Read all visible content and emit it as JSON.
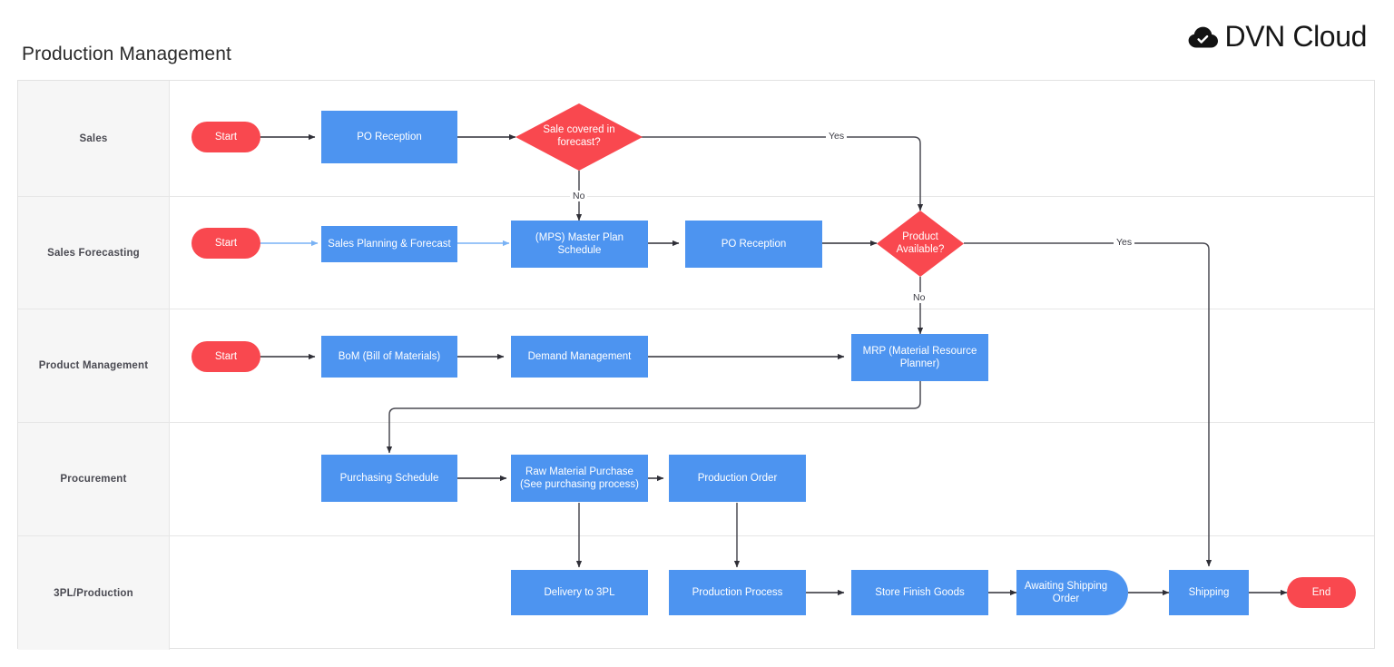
{
  "page": {
    "title": "Production Management",
    "brand": "DVN Cloud",
    "brand_icon": "cloud-check-icon"
  },
  "colors": {
    "process_blue": "#4d94f0",
    "terminator_red": "#f9484f",
    "decision_red": "#f9484f",
    "lane_header_bg": "#f6f6f6",
    "lane_border": "#e6e6e6",
    "connector_dark": "#3c3c44",
    "connector_blue": "#79b2f5",
    "text_dark": "#2b2b2b"
  },
  "lanes": [
    {
      "id": "sales",
      "label": "Sales"
    },
    {
      "id": "sales-forecasting",
      "label": "Sales Forecasting"
    },
    {
      "id": "product-management",
      "label": "Product Management"
    },
    {
      "id": "procurement",
      "label": "Procurement"
    },
    {
      "id": "3pl-production",
      "label": "3PL/Production"
    }
  ],
  "nodes": [
    {
      "id": "start-sales",
      "lane": "sales",
      "shape": "terminator",
      "label": "Start"
    },
    {
      "id": "po-reception-sales",
      "lane": "sales",
      "shape": "process",
      "label": "PO Reception"
    },
    {
      "id": "sale-covered",
      "lane": "sales",
      "shape": "decision",
      "label": "Sale covered in forecast?"
    },
    {
      "id": "start-forecasting",
      "lane": "sales-forecasting",
      "shape": "terminator",
      "label": "Start"
    },
    {
      "id": "sales-planning",
      "lane": "sales-forecasting",
      "shape": "process",
      "label": "Sales Planning & Forecast"
    },
    {
      "id": "mps",
      "lane": "sales-forecasting",
      "shape": "process",
      "label": "(MPS) Master Plan Schedule"
    },
    {
      "id": "po-reception-forecast",
      "lane": "sales-forecasting",
      "shape": "process",
      "label": "PO Reception"
    },
    {
      "id": "product-available",
      "lane": "sales-forecasting",
      "shape": "decision",
      "label": "Product Available?"
    },
    {
      "id": "start-product",
      "lane": "product-management",
      "shape": "terminator",
      "label": "Start"
    },
    {
      "id": "bom",
      "lane": "product-management",
      "shape": "process",
      "label": "BoM (Bill of Materials)"
    },
    {
      "id": "demand-management",
      "lane": "product-management",
      "shape": "process",
      "label": "Demand Management"
    },
    {
      "id": "mrp",
      "lane": "product-management",
      "shape": "process",
      "label": "MRP (Material Resource Planner)"
    },
    {
      "id": "purchasing-schedule",
      "lane": "procurement",
      "shape": "process",
      "label": "Purchasing Schedule"
    },
    {
      "id": "raw-material-purchase",
      "lane": "procurement",
      "shape": "process",
      "label": "Raw Material Purchase (See purchasing process)"
    },
    {
      "id": "production-order",
      "lane": "procurement",
      "shape": "process",
      "label": "Production Order"
    },
    {
      "id": "delivery-to-3pl",
      "lane": "3pl-production",
      "shape": "process",
      "label": "Delivery to 3PL"
    },
    {
      "id": "production-process",
      "lane": "3pl-production",
      "shape": "process",
      "label": "Production Process"
    },
    {
      "id": "store-finish-goods",
      "lane": "3pl-production",
      "shape": "process",
      "label": "Store Finish Goods"
    },
    {
      "id": "awaiting-shipping",
      "lane": "3pl-production",
      "shape": "delay",
      "label": "Awaiting Shipping Order"
    },
    {
      "id": "shipping",
      "lane": "3pl-production",
      "shape": "process",
      "label": "Shipping"
    },
    {
      "id": "end",
      "lane": "3pl-production",
      "shape": "terminator",
      "label": "End"
    }
  ],
  "node_labels": {
    "start_sales": "Start",
    "po_reception_sales": "PO Reception",
    "sale_covered_l1": "Sale covered in",
    "sale_covered_l2": "forecast?",
    "start_forecasting": "Start",
    "sales_planning": "Sales Planning & Forecast",
    "mps_l1": "(MPS) Master Plan",
    "mps_l2": "Schedule",
    "po_reception_forecast": "PO Reception",
    "product_available_l1": "Product",
    "product_available_l2": "Available?",
    "start_product": "Start",
    "bom": "BoM (Bill of Materials)",
    "demand_management": "Demand Management",
    "mrp_l1": "MRP (Material Resource",
    "mrp_l2": "Planner)",
    "purchasing_schedule": "Purchasing Schedule",
    "raw_material_l1": "Raw Material Purchase",
    "raw_material_l2": "(See purchasing process)",
    "production_order": "Production Order",
    "delivery_to_3pl": "Delivery to 3PL",
    "production_process": "Production Process",
    "store_finish_goods": "Store Finish Goods",
    "awaiting_shipping_l1": "Awaiting Shipping",
    "awaiting_shipping_l2": "Order",
    "shipping": "Shipping",
    "end": "End"
  },
  "edge_labels": {
    "sale_covered_yes": "Yes",
    "sale_covered_no": "No",
    "product_available_yes": "Yes",
    "product_available_no": "No"
  },
  "edges": [
    {
      "from": "start-sales",
      "to": "po-reception-sales",
      "label": ""
    },
    {
      "from": "po-reception-sales",
      "to": "sale-covered",
      "label": ""
    },
    {
      "from": "sale-covered",
      "to": "product-available",
      "label": "Yes"
    },
    {
      "from": "sale-covered",
      "to": "mps",
      "label": "No"
    },
    {
      "from": "start-forecasting",
      "to": "sales-planning",
      "label": ""
    },
    {
      "from": "sales-planning",
      "to": "mps",
      "label": ""
    },
    {
      "from": "mps",
      "to": "po-reception-forecast",
      "label": ""
    },
    {
      "from": "po-reception-forecast",
      "to": "product-available",
      "label": ""
    },
    {
      "from": "product-available",
      "to": "shipping",
      "label": "Yes"
    },
    {
      "from": "product-available",
      "to": "mrp",
      "label": "No"
    },
    {
      "from": "start-product",
      "to": "bom",
      "label": ""
    },
    {
      "from": "bom",
      "to": "demand-management",
      "label": ""
    },
    {
      "from": "demand-management",
      "to": "mrp",
      "label": ""
    },
    {
      "from": "mrp",
      "to": "purchasing-schedule",
      "label": ""
    },
    {
      "from": "purchasing-schedule",
      "to": "raw-material-purchase",
      "label": ""
    },
    {
      "from": "raw-material-purchase",
      "to": "production-order",
      "label": ""
    },
    {
      "from": "raw-material-purchase",
      "to": "delivery-to-3pl",
      "label": ""
    },
    {
      "from": "production-order",
      "to": "production-process",
      "label": ""
    },
    {
      "from": "production-process",
      "to": "store-finish-goods",
      "label": ""
    },
    {
      "from": "store-finish-goods",
      "to": "awaiting-shipping",
      "label": ""
    },
    {
      "from": "awaiting-shipping",
      "to": "shipping",
      "label": ""
    },
    {
      "from": "shipping",
      "to": "end",
      "label": ""
    }
  ]
}
